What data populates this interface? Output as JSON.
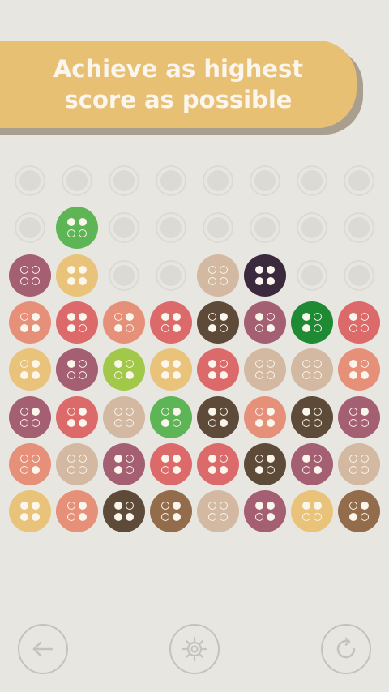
{
  "banner": {
    "line1": "Achieve as highest",
    "line2": "score as possible"
  },
  "colors": {
    "background": "#e8e6e0",
    "banner": "#e8c074",
    "banner_shadow": "#a89f8f",
    "banner_text": "#faf6ee",
    "empty_slot": "#dcdad4",
    "button_outline": "#c4c2bc",
    "palette": {
      "plum": "#a45f72",
      "salmon": "#e6907a",
      "coral": "#dd6a6a",
      "cocoa": "#5e4a38",
      "sand": "#e9c37a",
      "green": "#5db556",
      "darkgreen": "#1f8a34",
      "lime": "#a2c84a",
      "tan": "#d3b8a2",
      "midnight": "#3b2a3e",
      "mocha": "#936c4c"
    }
  },
  "board": {
    "columns": 8,
    "rows": [
      [
        null,
        null,
        null,
        null,
        null,
        null,
        null,
        null
      ],
      [
        null,
        {
          "color": "green",
          "pattern": [
            1,
            1,
            0,
            0
          ]
        },
        null,
        null,
        null,
        null,
        null,
        null
      ],
      [
        {
          "color": "plum",
          "pattern": [
            0,
            0,
            0,
            0
          ]
        },
        {
          "color": "sand",
          "pattern": [
            1,
            1,
            1,
            1
          ]
        },
        null,
        null,
        {
          "color": "tan",
          "pattern": [
            0,
            0,
            0,
            0
          ]
        },
        {
          "color": "midnight",
          "pattern": [
            1,
            1,
            1,
            1
          ]
        },
        null,
        null
      ],
      [
        {
          "color": "salmon",
          "pattern": [
            0,
            1,
            1,
            1
          ]
        },
        {
          "color": "coral",
          "pattern": [
            1,
            1,
            1,
            0
          ]
        },
        {
          "color": "salmon",
          "pattern": [
            0,
            1,
            1,
            0
          ]
        },
        {
          "color": "coral",
          "pattern": [
            1,
            1,
            0,
            1
          ]
        },
        {
          "color": "cocoa",
          "pattern": [
            0,
            1,
            1,
            0
          ]
        },
        {
          "color": "plum",
          "pattern": [
            1,
            0,
            0,
            1
          ]
        },
        {
          "color": "darkgreen",
          "pattern": [
            1,
            0,
            1,
            0
          ]
        },
        {
          "color": "coral",
          "pattern": [
            1,
            0,
            0,
            0
          ]
        }
      ],
      [
        {
          "color": "sand",
          "pattern": [
            0,
            1,
            1,
            1
          ]
        },
        {
          "color": "plum",
          "pattern": [
            1,
            0,
            0,
            0
          ]
        },
        {
          "color": "lime",
          "pattern": [
            1,
            0,
            0,
            1
          ]
        },
        {
          "color": "sand",
          "pattern": [
            1,
            1,
            1,
            1
          ]
        },
        {
          "color": "coral",
          "pattern": [
            1,
            0,
            1,
            1
          ]
        },
        {
          "color": "tan",
          "pattern": [
            0,
            0,
            0,
            0
          ]
        },
        {
          "color": "tan",
          "pattern": [
            0,
            0,
            0,
            0
          ]
        },
        {
          "color": "salmon",
          "pattern": [
            1,
            0,
            1,
            1
          ]
        }
      ],
      [
        {
          "color": "plum",
          "pattern": [
            0,
            1,
            0,
            0
          ]
        },
        {
          "color": "coral",
          "pattern": [
            0,
            1,
            1,
            1
          ]
        },
        {
          "color": "tan",
          "pattern": [
            0,
            0,
            0,
            0
          ]
        },
        {
          "color": "green",
          "pattern": [
            0,
            1,
            1,
            0
          ]
        },
        {
          "color": "cocoa",
          "pattern": [
            1,
            0,
            0,
            1
          ]
        },
        {
          "color": "salmon",
          "pattern": [
            0,
            1,
            1,
            1
          ]
        },
        {
          "color": "cocoa",
          "pattern": [
            1,
            0,
            0,
            0
          ]
        },
        {
          "color": "plum",
          "pattern": [
            0,
            1,
            0,
            0
          ]
        }
      ],
      [
        {
          "color": "salmon",
          "pattern": [
            0,
            0,
            0,
            1
          ]
        },
        {
          "color": "tan",
          "pattern": [
            0,
            0,
            0,
            0
          ]
        },
        {
          "color": "plum",
          "pattern": [
            1,
            0,
            1,
            0
          ]
        },
        {
          "color": "coral",
          "pattern": [
            1,
            1,
            0,
            1
          ]
        },
        {
          "color": "coral",
          "pattern": [
            1,
            0,
            1,
            1
          ]
        },
        {
          "color": "cocoa",
          "pattern": [
            0,
            1,
            1,
            0
          ]
        },
        {
          "color": "plum",
          "pattern": [
            1,
            0,
            0,
            1
          ]
        },
        {
          "color": "tan",
          "pattern": [
            0,
            0,
            0,
            0
          ]
        }
      ],
      [
        {
          "color": "sand",
          "pattern": [
            1,
            1,
            1,
            1
          ]
        },
        {
          "color": "salmon",
          "pattern": [
            0,
            1,
            0,
            1
          ]
        },
        {
          "color": "cocoa",
          "pattern": [
            1,
            0,
            1,
            1
          ]
        },
        {
          "color": "mocha",
          "pattern": [
            0,
            1,
            0,
            1
          ]
        },
        {
          "color": "tan",
          "pattern": [
            0,
            0,
            0,
            0
          ]
        },
        {
          "color": "plum",
          "pattern": [
            1,
            1,
            0,
            1
          ]
        },
        {
          "color": "sand",
          "pattern": [
            1,
            1,
            0,
            0
          ]
        },
        {
          "color": "mocha",
          "pattern": [
            0,
            1,
            1,
            0
          ]
        }
      ]
    ]
  },
  "controls": {
    "back_icon": "arrow-left-icon",
    "settings_icon": "gear-icon",
    "restart_icon": "restart-icon"
  }
}
